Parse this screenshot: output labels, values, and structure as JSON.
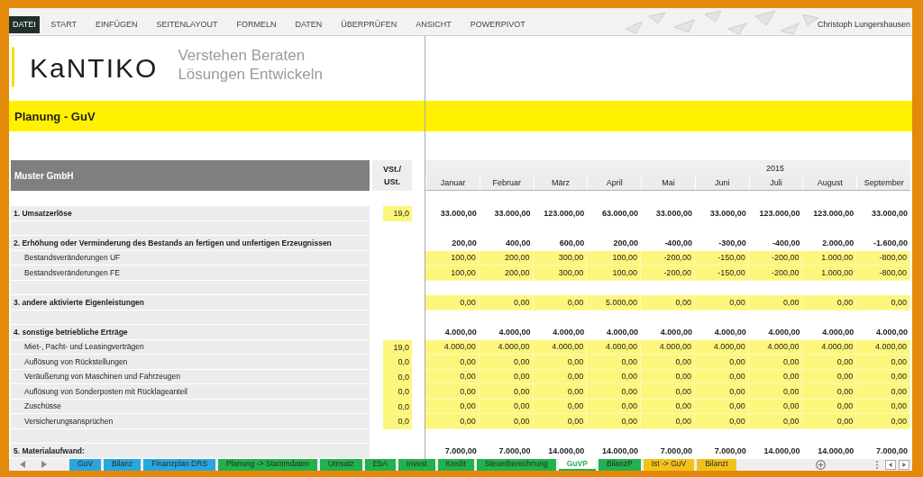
{
  "ribbon": {
    "file_button": "DATEI",
    "tabs": [
      "START",
      "EINFÜGEN",
      "SEITENLAYOUT",
      "FORMELN",
      "DATEN",
      "ÜBERPRÜFEN",
      "ANSICHT",
      "POWERPIVOT"
    ],
    "user": "Christoph Lungershausen"
  },
  "logo": {
    "wordmark": "KaNTIKO",
    "tagline": [
      "Verstehen Beraten",
      "Lösungen Entwickeln"
    ]
  },
  "title": "Planung - GuV",
  "table": {
    "company": "Muster GmbH",
    "vat_header": [
      "VSt./",
      "USt."
    ],
    "year": "2015",
    "months": [
      "Januar",
      "Februar",
      "März",
      "April",
      "Mai",
      "Juni",
      "Juli",
      "August",
      "September"
    ],
    "rows": [
      {
        "kind": "section",
        "label": "1. Umsatzerlöse",
        "vat": "19,0",
        "input": false,
        "values": [
          "33.000,00",
          "33.000,00",
          "123.000,00",
          "63.000,00",
          "33.000,00",
          "33.000,00",
          "123.000,00",
          "123.000,00",
          "33.000,00"
        ]
      },
      {
        "kind": "spacer"
      },
      {
        "kind": "section",
        "label": "2. Erhöhung oder Verminderung des Bestands an fertigen und unfertigen Erzeugnissen",
        "input": false,
        "values": [
          "200,00",
          "400,00",
          "600,00",
          "200,00",
          "-400,00",
          "-300,00",
          "-400,00",
          "2.000,00",
          "-1.600,00"
        ]
      },
      {
        "kind": "item",
        "label": "Bestandsveränderungen UF",
        "input": true,
        "values": [
          "100,00",
          "200,00",
          "300,00",
          "100,00",
          "-200,00",
          "-150,00",
          "-200,00",
          "1.000,00",
          "-800,00"
        ]
      },
      {
        "kind": "item",
        "label": "Bestandsveränderungen FE",
        "input": true,
        "values": [
          "100,00",
          "200,00",
          "300,00",
          "100,00",
          "-200,00",
          "-150,00",
          "-200,00",
          "1.000,00",
          "-800,00"
        ]
      },
      {
        "kind": "spacer"
      },
      {
        "kind": "section",
        "label": "3. andere aktivierte Eigenleistungen",
        "input": true,
        "values": [
          "0,00",
          "0,00",
          "0,00",
          "5.000,00",
          "0,00",
          "0,00",
          "0,00",
          "0,00",
          "0,00"
        ]
      },
      {
        "kind": "spacer"
      },
      {
        "kind": "section",
        "label": "4. sonstige betriebliche Erträge",
        "input": false,
        "values": [
          "4.000,00",
          "4.000,00",
          "4.000,00",
          "4.000,00",
          "4.000,00",
          "4.000,00",
          "4.000,00",
          "4.000,00",
          "4.000,00"
        ]
      },
      {
        "kind": "item",
        "label": "Miet-, Pacht- und Leasingverträgen",
        "vat": "19,0",
        "input": true,
        "values": [
          "4.000,00",
          "4.000,00",
          "4.000,00",
          "4.000,00",
          "4.000,00",
          "4.000,00",
          "4.000,00",
          "4.000,00",
          "4.000,00"
        ]
      },
      {
        "kind": "item",
        "label": "Auflösung von Rückstellungen",
        "vat": "0,0",
        "input": true,
        "values": [
          "0,00",
          "0,00",
          "0,00",
          "0,00",
          "0,00",
          "0,00",
          "0,00",
          "0,00",
          "0,00"
        ]
      },
      {
        "kind": "item",
        "label": "Veräußerung von Maschinen und Fahrzeugen",
        "vat": "0,0",
        "input": true,
        "values": [
          "0,00",
          "0,00",
          "0,00",
          "0,00",
          "0,00",
          "0,00",
          "0,00",
          "0,00",
          "0,00"
        ]
      },
      {
        "kind": "item",
        "label": "Auflösung von Sonderposten mit Rücklageanteil",
        "vat": "0,0",
        "input": true,
        "values": [
          "0,00",
          "0,00",
          "0,00",
          "0,00",
          "0,00",
          "0,00",
          "0,00",
          "0,00",
          "0,00"
        ]
      },
      {
        "kind": "item",
        "label": "Zuschüsse",
        "vat": "0,0",
        "input": true,
        "values": [
          "0,00",
          "0,00",
          "0,00",
          "0,00",
          "0,00",
          "0,00",
          "0,00",
          "0,00",
          "0,00"
        ]
      },
      {
        "kind": "item",
        "label": "Versicherungsansprüchen",
        "vat": "0,0",
        "input": true,
        "values": [
          "0,00",
          "0,00",
          "0,00",
          "0,00",
          "0,00",
          "0,00",
          "0,00",
          "0,00",
          "0,00"
        ]
      },
      {
        "kind": "spacer"
      },
      {
        "kind": "section",
        "label": "5. Materialaufwand:",
        "input": false,
        "values": [
          "7.000,00",
          "7.000,00",
          "14.000,00",
          "14.000,00",
          "7.000,00",
          "7.000,00",
          "14.000,00",
          "14.000,00",
          "7.000,00"
        ]
      }
    ]
  },
  "sheet_tabs": [
    {
      "label": "GuV",
      "color": "#2aa6dd",
      "selected": false
    },
    {
      "label": "Bilanz",
      "color": "#2aa6dd",
      "selected": false
    },
    {
      "label": "Finanzplan DRS",
      "color": "#2aa6dd",
      "selected": false
    },
    {
      "label": "Planung -> Stammdaten",
      "color": "#22b14c",
      "selected": false
    },
    {
      "label": "Umsatz",
      "color": "#22b14c",
      "selected": false
    },
    {
      "label": "EbA",
      "color": "#22b14c",
      "selected": false
    },
    {
      "label": "Invest",
      "color": "#22b14c",
      "selected": false
    },
    {
      "label": "Kredit",
      "color": "#22b14c",
      "selected": false
    },
    {
      "label": "Steuerberechnung",
      "color": "#22b14c",
      "selected": false
    },
    {
      "label": "GuVP",
      "color": "#22b14c",
      "selected": true
    },
    {
      "label": "BilanzP",
      "color": "#22b14c",
      "selected": false
    },
    {
      "label": "Ist -> GuV",
      "color": "#f2c21b",
      "selected": false
    },
    {
      "label": "BilanzI",
      "color": "#f2c21b",
      "selected": false
    }
  ]
}
